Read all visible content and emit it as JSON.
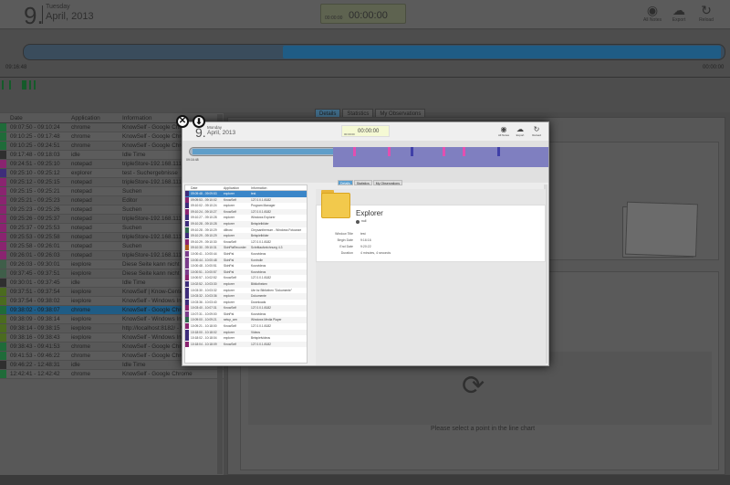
{
  "header": {
    "day_number": "9.",
    "weekday": "Tuesday",
    "date": "April, 2013",
    "timer_small": "00:00:00",
    "timer_big": "00:00:00",
    "buttons": [
      {
        "label": "All Notes",
        "icon": "eye-icon"
      },
      {
        "label": "Export",
        "icon": "cloud-download-icon"
      },
      {
        "label": "Reload",
        "icon": "refresh-icon"
      }
    ]
  },
  "timeline": {
    "start": "09:16:48",
    "end": "00:00:00"
  },
  "tabs": [
    "Details",
    "Statistics",
    "My Observations"
  ],
  "table": {
    "columns": [
      "Date",
      "Application",
      "Information"
    ],
    "rows": [
      {
        "date": "09:07:50 - 09:10:24",
        "app": "chrome",
        "info": "KnowSelf - Google Chro",
        "color": "#1f6b39"
      },
      {
        "date": "09:10:25 - 09:17:48",
        "app": "chrome",
        "info": "KnowSelf - Google Chrom",
        "color": "#1f6b39"
      },
      {
        "date": "09:10:25 - 09:24:51",
        "app": "chrome",
        "info": "KnowSelf - Google Chrom",
        "color": "#1f6b39"
      },
      {
        "date": "09:17:48 - 09:18:03",
        "app": "idle",
        "info": "Idle Time",
        "color": "#2f2f2f"
      },
      {
        "date": "09:24:51 - 09:25:10",
        "app": "notepad",
        "info": "tripleStore-192.168.111",
        "color": "#8a2470"
      },
      {
        "date": "09:25:10 - 09:25:12",
        "app": "explorer",
        "info": "test - Suchergebnisse",
        "color": "#3e2d7a"
      },
      {
        "date": "09:25:12 - 09:25:15",
        "app": "notepad",
        "info": "tripleStore-192.168.111",
        "color": "#8a2470"
      },
      {
        "date": "09:25:15 - 09:25:21",
        "app": "notepad",
        "info": "Suchen",
        "color": "#8a2470"
      },
      {
        "date": "09:25:21 - 09:25:23",
        "app": "notepad",
        "info": "Editor",
        "color": "#8a2470"
      },
      {
        "date": "09:25:23 - 09:25:26",
        "app": "notepad",
        "info": "Suchen",
        "color": "#8a2470"
      },
      {
        "date": "09:25:26 - 09:25:37",
        "app": "notepad",
        "info": "tripleStore-192.168.111",
        "color": "#8a2470"
      },
      {
        "date": "09:25:37 - 09:25:53",
        "app": "notepad",
        "info": "Suchen",
        "color": "#8a2470"
      },
      {
        "date": "09:25:53 - 09:25:58",
        "app": "notepad",
        "info": "tripleStore-192.168.111",
        "color": "#8a2470"
      },
      {
        "date": "09:25:58 - 09:26:01",
        "app": "notepad",
        "info": "Suchen",
        "color": "#8a2470"
      },
      {
        "date": "09:26:01 - 09:26:03",
        "app": "notepad",
        "info": "tripleStore-192.168.111",
        "color": "#8a2470"
      },
      {
        "date": "09:26:03 - 09:30:01",
        "app": "iexplore",
        "info": "Diese Seite kann nicht",
        "color": "#3f5e49"
      },
      {
        "date": "09:37:45 - 09:37:51",
        "app": "iexplore",
        "info": "Diese Seite kann nicht",
        "color": "#3f5e49"
      },
      {
        "date": "09:30:01 - 09:37:45",
        "app": "idle",
        "info": "Idle Time",
        "color": "#2f2f2f"
      },
      {
        "date": "09:37:51 - 09:37:54",
        "app": "iexplore",
        "info": "KnowSelf | Know-Cente",
        "color": "#4b6b1f"
      },
      {
        "date": "09:37:54 - 09:38:02",
        "app": "iexplore",
        "info": "KnowSelf - Windows Int",
        "color": "#4b6b1f"
      },
      {
        "date": "09:38:02 - 09:38:07",
        "app": "chrome",
        "info": "KnowSelf - Google Chrome",
        "color": "#1f6b39",
        "selected": true
      },
      {
        "date": "09:38:09 - 09:38:14",
        "app": "iexplore",
        "info": "KnowSelf - Windows Internet Explo",
        "color": "#4b6b1f"
      },
      {
        "date": "09:38:14 - 09:38:15",
        "app": "iexplore",
        "info": "http://localhost:8182/ - Windows Int",
        "color": "#4b6b1f"
      },
      {
        "date": "09:38:16 - 09:38:43",
        "app": "iexplore",
        "info": "KnowSelf - Windows Internet Explo",
        "color": "#4b6b1f"
      },
      {
        "date": "09:38:43 - 09:41:53",
        "app": "chrome",
        "info": "KnowSelf - Google Chrome",
        "color": "#1f6b39"
      },
      {
        "date": "09:41:53 - 09:46:22",
        "app": "chrome",
        "info": "KnowSelf - Google Chrome",
        "color": "#1f6b39"
      },
      {
        "date": "09:46:22 - 12:48:31",
        "app": "idle",
        "info": "Idle Time",
        "color": "#2f2f2f"
      },
      {
        "date": "12:42:41 - 12:42:42",
        "app": "chrome",
        "info": "KnowSelf - Google Chrome",
        "color": "#1f6b39"
      }
    ]
  },
  "right": {
    "select_message": "Please select a point in the line chart"
  },
  "modal": {
    "day_number": "9.",
    "weekday": "Monday",
    "date": "April, 2013",
    "timer_small": "00:00:00",
    "timer_big": "00:00:00",
    "buttons": [
      {
        "label": "All Notes",
        "icon": "eye-icon"
      },
      {
        "label": "Export",
        "icon": "cloud-download-icon"
      },
      {
        "label": "Reload",
        "icon": "refresh-icon"
      }
    ],
    "tl_start": "09:16:48",
    "tl_end": "00:00:00",
    "tabs": [
      "Details",
      "Statistics",
      "My Observations"
    ],
    "columns": [
      "Date",
      "Application",
      "Information"
    ],
    "rows": [
      {
        "date": "09:09:48 - 09:09:53",
        "app": "explorer",
        "info": "test",
        "color": "#3e2d7a",
        "selected": true
      },
      {
        "date": "09:09:53 - 09:10:02",
        "app": "KnowSelf",
        "info": "127.0.0.1:8182",
        "color": "#8a2470"
      },
      {
        "date": "09:10:02 - 09:10:24",
        "app": "explorer",
        "info": "Program Manager",
        "color": "#3e2d7a"
      },
      {
        "date": "09:10:24 - 09:10:27",
        "app": "KnowSelf",
        "info": "127.0.0.1:8182",
        "color": "#8a2470"
      },
      {
        "date": "09:10:27 - 09:10:28",
        "app": "explorer",
        "info": "Windows Explorer",
        "color": "#3e2d7a"
      },
      {
        "date": "09:10:28 - 09:10:28",
        "app": "explorer",
        "info": "Beispielbilder",
        "color": "#3e2d7a"
      },
      {
        "date": "09:10:28 - 09:10:29",
        "app": "dllhost",
        "info": "Chrysanthemum - Windows Fotoanze",
        "color": "#2f6b4f"
      },
      {
        "date": "09:10:29 - 09:10:29",
        "app": "explorer",
        "info": "Beispielbilder",
        "color": "#3e2d7a"
      },
      {
        "date": "09:10:29 - 09:10:30",
        "app": "KnowSelf",
        "info": "127.0.0.1:8182",
        "color": "#8a2470"
      },
      {
        "date": "09:10:30 - 09:10:31",
        "app": "SkinPlaRecorder",
        "info": "Schrittaufzeichnung 4.3",
        "color": "#b05a1c"
      },
      {
        "date": "10:00:41 - 10:00:44",
        "app": "SkinPal",
        "info": "Kurzvideos",
        "color": "#7a3d8a"
      },
      {
        "date": "10:00:44 - 10:00:48",
        "app": "SkinPal",
        "info": "Kontrolle",
        "color": "#7a3d8a"
      },
      {
        "date": "10:00:48 - 10:00:51",
        "app": "SkinPal",
        "info": "Kurzvideos",
        "color": "#7a3d8a"
      },
      {
        "date": "10:00:51 - 10:00:57",
        "app": "SkinPal",
        "info": "Kurzvideos",
        "color": "#7a3d8a"
      },
      {
        "date": "10:00:57 - 10:02:52",
        "app": "KnowSelf",
        "info": "127.0.0.1:8182",
        "color": "#8a2470"
      },
      {
        "date": "10:02:52 - 10:03:30",
        "app": "explorer",
        "info": "Bibliotheken",
        "color": "#3e2d7a"
      },
      {
        "date": "10:03:30 - 10:03:32",
        "app": "explorer",
        "info": "Ute bz Bibliothen \"Dokumente\"",
        "color": "#3e2d7a"
      },
      {
        "date": "10:03:32 - 10:03:36",
        "app": "explorer",
        "info": "Dokumente",
        "color": "#3e2d7a"
      },
      {
        "date": "10:03:36 - 10:03:40",
        "app": "explorer",
        "info": "Downloads",
        "color": "#3e2d7a"
      },
      {
        "date": "10:03:40 - 10:07:31",
        "app": "KnowSelf",
        "info": "127.0.0.1:8182",
        "color": "#8a2470"
      },
      {
        "date": "10:07:31 - 10:09:00",
        "app": "SkinPal",
        "info": "Kurzvideos",
        "color": "#7a3d8a"
      },
      {
        "date": "10:09:00 - 10:09:21",
        "app": "setup_wm",
        "info": "Windows Media Player",
        "color": "#2f6b4f"
      },
      {
        "date": "10:09:21 - 10:18:00",
        "app": "KnowSelf",
        "info": "127.0.0.1:8182",
        "color": "#8a2470"
      },
      {
        "date": "10:18:00 - 10:18:02",
        "app": "explorer",
        "info": "Videos",
        "color": "#3e2d7a"
      },
      {
        "date": "10:18:02 - 10:18:04",
        "app": "explorer",
        "info": "Beispielvideos",
        "color": "#3e2d7a"
      },
      {
        "date": "10:18:04 - 10:18:09",
        "app": "KnowSelf",
        "info": "127.0.0.1:8182",
        "color": "#8a2470"
      }
    ],
    "detail": {
      "title": "Explorer",
      "sub": "null",
      "fields": [
        {
          "k": "Window Title",
          "v": "test"
        },
        {
          "k": "Begin Date",
          "v": "9:16:16"
        },
        {
          "k": "End Date",
          "v": "9:20:22"
        },
        {
          "k": "Duration",
          "v": "4 minutes, 4 seconds"
        }
      ]
    },
    "close_icon": "close-icon",
    "download_icon": "download-icon"
  }
}
